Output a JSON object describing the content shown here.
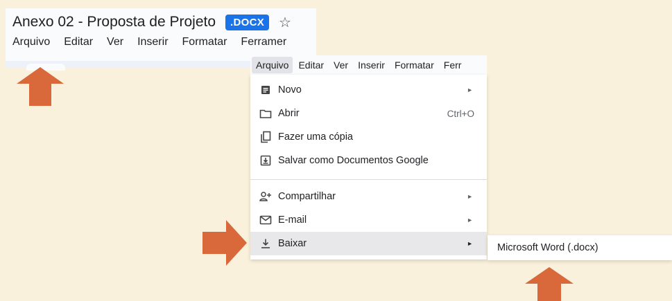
{
  "document": {
    "title": "Anexo 02 - Proposta de Projeto",
    "format_badge": ".DOCX"
  },
  "menubar": {
    "items": [
      "Arquivo",
      "Editar",
      "Ver",
      "Inserir",
      "Formatar",
      "Ferramer"
    ]
  },
  "menubar_small": {
    "items": [
      "Arquivo",
      "Editar",
      "Ver",
      "Inserir",
      "Formatar",
      "Ferr"
    ]
  },
  "file_menu": {
    "items": [
      {
        "label": "Novo",
        "icon": "document-icon",
        "has_submenu": true
      },
      {
        "label": "Abrir",
        "icon": "folder-icon",
        "shortcut": "Ctrl+O"
      },
      {
        "label": "Fazer uma cópia",
        "icon": "copy-icon"
      },
      {
        "label": "Salvar como Documentos Google",
        "icon": "save-as-icon"
      },
      {
        "label": "Compartilhar",
        "icon": "person-add-icon",
        "has_submenu": true
      },
      {
        "label": "E-mail",
        "icon": "mail-icon",
        "has_submenu": true
      },
      {
        "label": "Baixar",
        "icon": "download-icon",
        "has_submenu": true,
        "highlighted": true
      }
    ]
  },
  "download_submenu": {
    "items": [
      "Microsoft Word (.docx)"
    ]
  },
  "colors": {
    "background": "#f9f1dc",
    "arrow": "#d9683b",
    "badge": "#1a73e8",
    "highlight": "#e8e8ea"
  }
}
